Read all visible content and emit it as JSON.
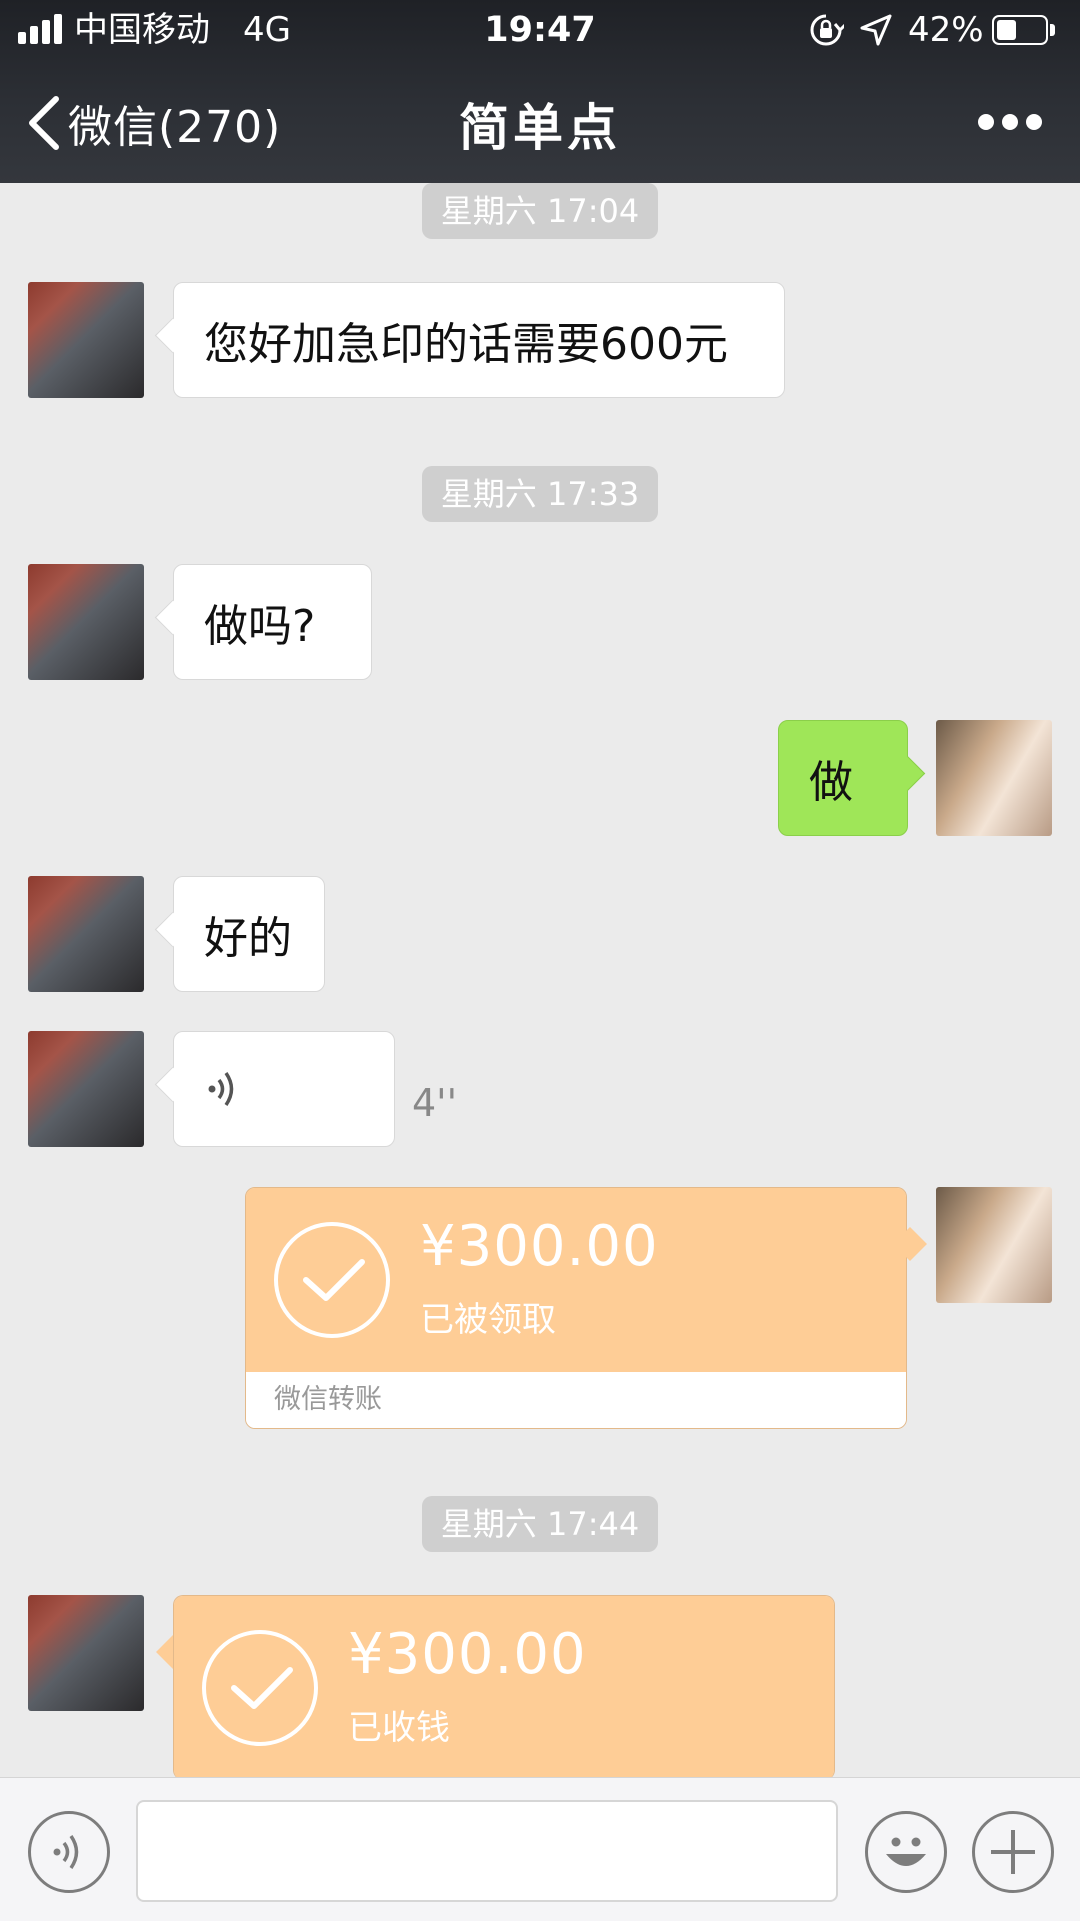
{
  "status_bar": {
    "carrier": "中国移动",
    "network": "4G",
    "time": "19:47",
    "battery": "42%",
    "battery_level": 0.42
  },
  "nav": {
    "back_label": "微信(270)",
    "title": "简单点"
  },
  "messages": {
    "ts1": "星期六 17:04",
    "msg1": "您好加急印的话需要600元",
    "ts2": "星期六 17:33",
    "msg2": "做吗?",
    "msg3": "做",
    "msg4": "好的",
    "voice_duration": "4''",
    "transfer1": {
      "amount": "¥300.00",
      "status": "已被领取",
      "footer": "微信转账"
    },
    "ts3": "星期六 17:44",
    "transfer2": {
      "amount": "¥300.00",
      "status": "已收钱"
    }
  },
  "colors": {
    "header_bg": "#2c2f35",
    "chat_bg": "#ebebeb",
    "my_bubble": "#9fe658",
    "transfer": "#fecd96"
  },
  "icons": [
    "signal-icon",
    "orientation-lock-icon",
    "location-arrow-icon",
    "battery-icon",
    "chevron-left-icon",
    "more-icon",
    "voice-icon",
    "check-icon",
    "emoji-icon",
    "plus-icon"
  ]
}
